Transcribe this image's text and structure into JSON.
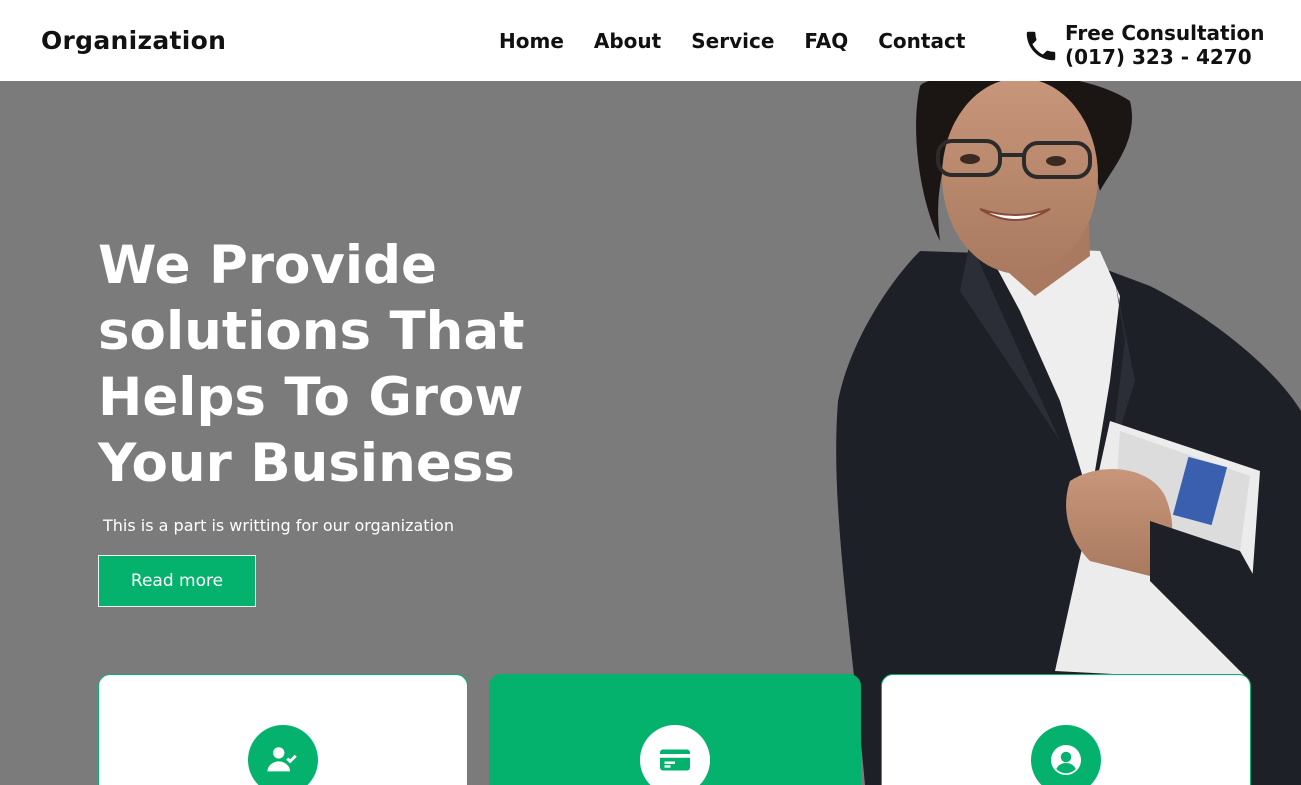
{
  "brand": "Organization",
  "nav": [
    "Home",
    "About",
    "Service",
    "FAQ",
    "Contact"
  ],
  "contact": {
    "title": "Free Consultation",
    "phone": "(017) 323 - 4270",
    "icon": "phone-icon"
  },
  "hero": {
    "title_lines": [
      "We Provide",
      "solutions That",
      "Helps To Grow",
      "Your Business"
    ],
    "subtitle": "This is a part is writting for our organization",
    "button": "Read more"
  },
  "features": [
    {
      "icon": "user-check-icon",
      "active": false
    },
    {
      "icon": "credit-card-icon",
      "active": true
    },
    {
      "icon": "user-circle-icon",
      "active": false
    }
  ],
  "colors": {
    "accent": "#05b26d",
    "hero_overlay": "#7b7b7b",
    "text_dark": "#111111"
  }
}
